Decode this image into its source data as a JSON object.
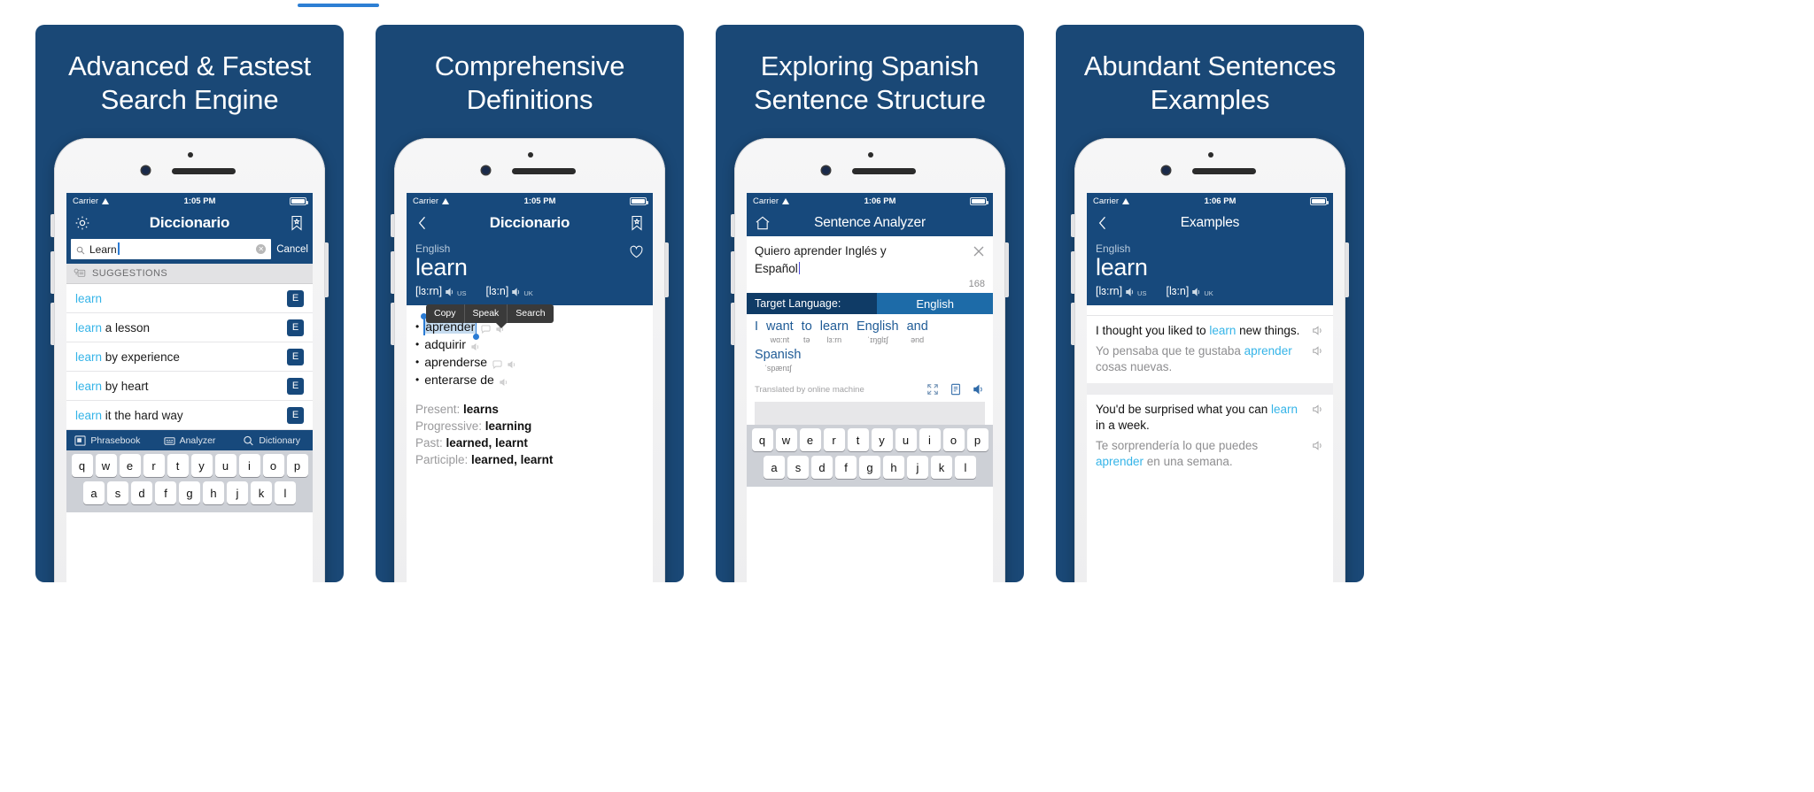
{
  "cards": [
    {
      "title": "Advanced & Fastest\nSearch Engine",
      "title_line1": "Advanced & Fastest",
      "title_line2": "Search Engine",
      "status": {
        "carrier": "Carrier",
        "time": "1:05 PM"
      },
      "navbar": {
        "title": "Diccionario",
        "left_icon": "gear-icon",
        "right_icon": "bookmark-star-icon"
      },
      "search": {
        "value": "Learn",
        "cancel_label": "Cancel",
        "clear_label": "✕"
      },
      "suggestions_header": "SUGGESTIONS",
      "suggestions": [
        {
          "highlight": "learn",
          "rest": "",
          "badge": "E"
        },
        {
          "highlight": "learn",
          "rest": " a lesson",
          "badge": "E"
        },
        {
          "highlight": "learn",
          "rest": " by experience",
          "badge": "E"
        },
        {
          "highlight": "learn",
          "rest": " by heart",
          "badge": "E"
        },
        {
          "highlight": "learn",
          "rest": " it the hard way",
          "badge": "E"
        }
      ],
      "tabs": [
        {
          "label": "Phrasebook",
          "icon": "book-icon"
        },
        {
          "label": "Analyzer",
          "icon": "analyzer-icon"
        },
        {
          "label": "Dictionary",
          "icon": "search-icon"
        }
      ],
      "keyboard": {
        "row1": [
          "q",
          "w",
          "e",
          "r",
          "t",
          "y",
          "u",
          "i",
          "o",
          "p"
        ],
        "row2": [
          "a",
          "s",
          "d",
          "f",
          "g",
          "h",
          "j",
          "k",
          "l"
        ]
      }
    },
    {
      "title_line1": "Comprehensive",
      "title_line2": "Definitions",
      "status": {
        "carrier": "Carrier",
        "time": "1:05 PM"
      },
      "navbar": {
        "title": "Diccionario",
        "left_icon": "back-chevron-icon",
        "right_icon": "bookmark-star-icon"
      },
      "entry": {
        "language": "English",
        "word": "learn",
        "pronunciations": [
          {
            "ipa": "[lɜ:rn]",
            "region": "US"
          },
          {
            "ipa": "[lɜ:n]",
            "region": "UK"
          }
        ],
        "favorite_icon": "heart-icon"
      },
      "context_menu": [
        "Copy",
        "Speak",
        "Search"
      ],
      "definitions": [
        {
          "text": "aprender",
          "selected": true
        },
        {
          "text": "adquirir",
          "selected": false
        },
        {
          "text": "aprenderse",
          "selected": false
        },
        {
          "text": "enterarse de",
          "selected": false
        }
      ],
      "forms": [
        {
          "label": "Present:",
          "value": "learns"
        },
        {
          "label": "Progressive:",
          "value": "learning"
        },
        {
          "label": "Past:",
          "value": "learned, learnt"
        },
        {
          "label": "Participle:",
          "value": "learned, learnt"
        }
      ]
    },
    {
      "title_line1": "Exploring Spanish",
      "title_line2": "Sentence Structure",
      "status": {
        "carrier": "Carrier",
        "time": "1:06 PM"
      },
      "navbar": {
        "title": "Sentence Analyzer",
        "left_icon": "home-icon"
      },
      "input": {
        "value_line1": "Quiero aprender Inglés y",
        "value_line2": "Español",
        "counter": "168",
        "clear_icon": "x-icon"
      },
      "target_language": {
        "label": "Target Language:",
        "value": "English"
      },
      "analysis": {
        "line1": [
          {
            "word": "I",
            "phonetic": ""
          },
          {
            "word": "want",
            "phonetic": "wɑ:nt"
          },
          {
            "word": "to",
            "phonetic": "tə"
          },
          {
            "word": "learn",
            "phonetic": "lɜ:rn"
          },
          {
            "word": "English",
            "phonetic": "ˈɪŋglɪʃ"
          },
          {
            "word": "and",
            "phonetic": "ənd"
          }
        ],
        "line2": [
          {
            "word": "Spanish",
            "phonetic": "ˈspænɪʃ"
          }
        ],
        "credit": "Translated by online machine",
        "icons": [
          "expand-icon",
          "document-icon",
          "speaker-icon"
        ]
      },
      "keyboard": {
        "row1": [
          "q",
          "w",
          "e",
          "r",
          "t",
          "y",
          "u",
          "i",
          "o",
          "p"
        ],
        "row2": [
          "a",
          "s",
          "d",
          "f",
          "g",
          "h",
          "j",
          "k",
          "l"
        ]
      }
    },
    {
      "title_line1": "Abundant Sentences",
      "title_line2": "Examples",
      "status": {
        "carrier": "Carrier",
        "time": "1:06 PM"
      },
      "navbar": {
        "title": "Examples",
        "left_icon": "back-chevron-icon"
      },
      "entry": {
        "language": "English",
        "word": "learn",
        "pronunciations": [
          {
            "ipa": "[lɜ:rn]",
            "region": "US"
          },
          {
            "ipa": "[lɜ:n]",
            "region": "UK"
          }
        ]
      },
      "examples": [
        {
          "en_pre": "I thought you liked to ",
          "en_hl": "learn",
          "en_post": " new things.",
          "es_hl": "aprender",
          "es_pre": "Yo pensaba que te gustaba ",
          "es_post": " cosas nuevas."
        },
        {
          "en_pre": "You'd be surprised what you can ",
          "en_hl": "learn",
          "en_post": " in a week.",
          "es_hl": "aprender",
          "es_pre": "Te sorprendería lo que puedes ",
          "es_post": " en una semana."
        }
      ]
    }
  ],
  "colors": {
    "brand_dark": "#1a4876",
    "navbar": "#17497c",
    "accent_cyan": "#35b4e8",
    "target_active": "#1d6ba8",
    "analysis_blue": "#1f5b96"
  }
}
